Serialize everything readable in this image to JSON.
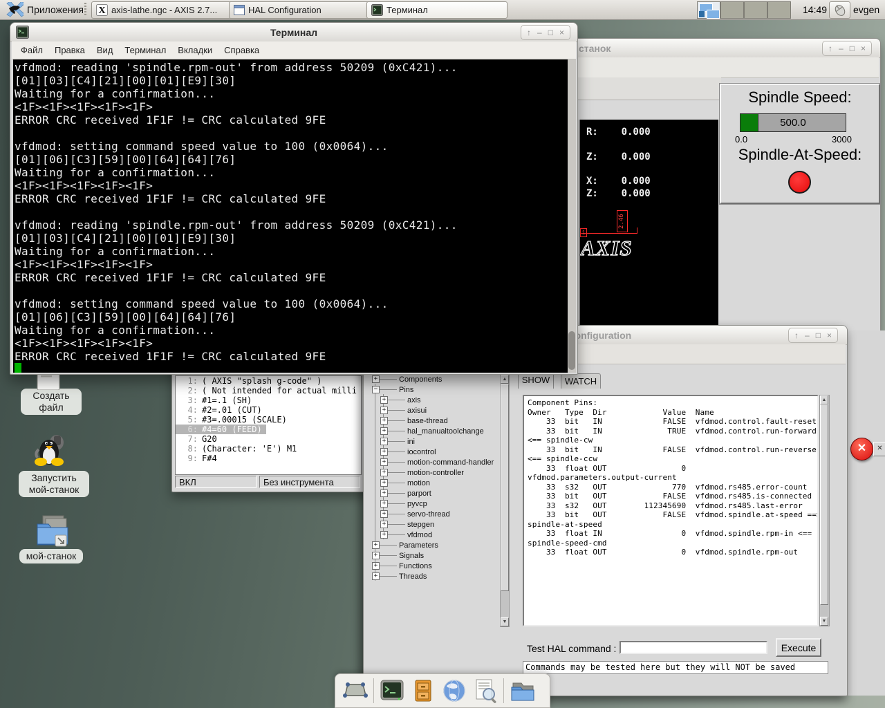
{
  "colors": {
    "desktop_left": "#3f4e49",
    "desktop_right": "#a8b1a5",
    "terminal_bg": "#000000",
    "terminal_text": "#e9e9e9",
    "cursor_green": "#00b400",
    "spindle_green": "#0a7d0a",
    "led_red": "#e30b0b",
    "error_red": "#da0d0d",
    "tk_gray": "#d9d9d9"
  },
  "chrome": {
    "controls": [
      "↑",
      "–",
      "□",
      "×"
    ]
  },
  "panel": {
    "app_menu": "Приложения",
    "tasks": [
      {
        "label": "axis-lathe.ngc - AXIS 2.7..."
      },
      {
        "label": "HAL Configuration"
      },
      {
        "label": "Терминал"
      }
    ],
    "time": "14:49",
    "user": "evgen"
  },
  "desktop": {
    "icons": [
      {
        "label": "Создать файл"
      },
      {
        "label": "Запустить мой-станок"
      },
      {
        "label": "мой-станок"
      }
    ]
  },
  "terminal": {
    "title": "Терминал",
    "menu": [
      "Файл",
      "Правка",
      "Вид",
      "Терминал",
      "Вкладки",
      "Справка"
    ],
    "lines": [
      "vfdmod: reading 'spindle.rpm-out' from address 50209 (0xC421)...",
      "[01][03][C4][21][00][01][E9][30]",
      "Waiting for a confirmation...",
      "<1F><1F><1F><1F><1F>",
      "ERROR CRC received 1F1F != CRC calculated 9FE",
      "",
      "vfdmod: setting command speed value to 100 (0x0064)...",
      "[01][06][C3][59][00][64][64][76]",
      "Waiting for a confirmation...",
      "<1F><1F><1F><1F><1F>",
      "ERROR CRC received 1F1F != CRC calculated 9FE",
      "",
      "vfdmod: reading 'spindle.rpm-out' from address 50209 (0xC421)...",
      "[01][03][C4][21][00][01][E9][30]",
      "Waiting for a confirmation...",
      "<1F><1F><1F><1F><1F>",
      "ERROR CRC received 1F1F != CRC calculated 9FE",
      "",
      "vfdmod: setting command speed value to 100 (0x0064)...",
      "[01][06][C3][59][00][64][64][76]",
      "Waiting for a confirmation...",
      "<1F><1F><1F><1F><1F>",
      "ERROR CRC received 1F1F != CRC calculated 9FE"
    ]
  },
  "axis": {
    "title_visible": "станок",
    "coords": [
      "R:    0.000",
      "Z:    0.000",
      "X:    0.000",
      "Z:    0.000"
    ],
    "dimension": "2.46",
    "dim_origin": "1",
    "splash": "AXIS",
    "gcode": [
      {
        "n": "1:",
        "text": "( AXIS \"splash g-code\" )"
      },
      {
        "n": "2:",
        "text": "( Not intended for actual milli"
      },
      {
        "n": "3:",
        "text": "#1=.1 (SH)"
      },
      {
        "n": "4:",
        "text": "#2=.01 (CUT)"
      },
      {
        "n": "5:",
        "text": "#3=.00015 (SCALE)"
      },
      {
        "n": "6:",
        "text": "#4=60 (FEED)",
        "hl": true
      },
      {
        "n": "7:",
        "text": "G20"
      },
      {
        "n": "8:",
        "text": "(Character: 'E') M1"
      },
      {
        "n": "9:",
        "text": "F#4"
      }
    ],
    "status_power": "ВКЛ",
    "status_tool": "Без инструмента",
    "pyvcp": {
      "title": "Spindle Speed:",
      "value": "500.0",
      "min": "0.0",
      "max": "3000",
      "bar_fraction": 0.167,
      "at_speed_label": "Spindle-At-Speed:"
    }
  },
  "hal": {
    "title": "HAL Configuration",
    "tabs": [
      "SHOW",
      "WATCH"
    ],
    "tree": [
      {
        "t": "Components",
        "l": 0,
        "b": "+"
      },
      {
        "t": "Pins",
        "l": 0,
        "b": "−"
      },
      {
        "t": "axis",
        "l": 1,
        "b": "+"
      },
      {
        "t": "axisui",
        "l": 1,
        "b": "+"
      },
      {
        "t": "base-thread",
        "l": 1,
        "b": "+"
      },
      {
        "t": "hal_manualtoolchange",
        "l": 1,
        "b": "+"
      },
      {
        "t": "ini",
        "l": 1,
        "b": "+"
      },
      {
        "t": "iocontrol",
        "l": 1,
        "b": "+"
      },
      {
        "t": "motion-command-handler",
        "l": 1,
        "b": "+"
      },
      {
        "t": "motion-controller",
        "l": 1,
        "b": "+"
      },
      {
        "t": "motion",
        "l": 1,
        "b": "+"
      },
      {
        "t": "parport",
        "l": 1,
        "b": "+"
      },
      {
        "t": "pyvcp",
        "l": 1,
        "b": "+"
      },
      {
        "t": "servo-thread",
        "l": 1,
        "b": "+"
      },
      {
        "t": "stepgen",
        "l": 1,
        "b": "+"
      },
      {
        "t": "vfdmod",
        "l": 1,
        "b": "+"
      },
      {
        "t": "Parameters",
        "l": 0,
        "b": "+"
      },
      {
        "t": "Signals",
        "l": 0,
        "b": "+"
      },
      {
        "t": "Functions",
        "l": 0,
        "b": "+"
      },
      {
        "t": "Threads",
        "l": 0,
        "b": "+"
      }
    ],
    "pins_lines": [
      "Component Pins:",
      "Owner   Type  Dir            Value  Name",
      "    33  bit   IN             FALSE  vfdmod.control.fault-reset",
      "    33  bit   IN              TRUE  vfdmod.control.run-forward",
      "<== spindle-cw",
      "    33  bit   IN             FALSE  vfdmod.control.run-reverse",
      "<== spindle-ccw",
      "    33  float OUT                0",
      "vfdmod.parameters.output-current",
      "    33  s32   OUT              770  vfdmod.rs485.error-count",
      "    33  bit   OUT            FALSE  vfdmod.rs485.is-connected",
      "    33  s32   OUT        112345690  vfdmod.rs485.last-error",
      "    33  bit   OUT            FALSE  vfdmod.spindle.at-speed ==>",
      "spindle-at-speed",
      "    33  float IN                 0  vfdmod.spindle.rpm-in <==",
      "spindle-speed-cmd",
      "    33  float OUT                0  vfdmod.spindle.rpm-out"
    ],
    "test_label": "Test HAL command :",
    "execute": "Execute",
    "note": "Commands may be tested here but they will NOT be saved"
  }
}
